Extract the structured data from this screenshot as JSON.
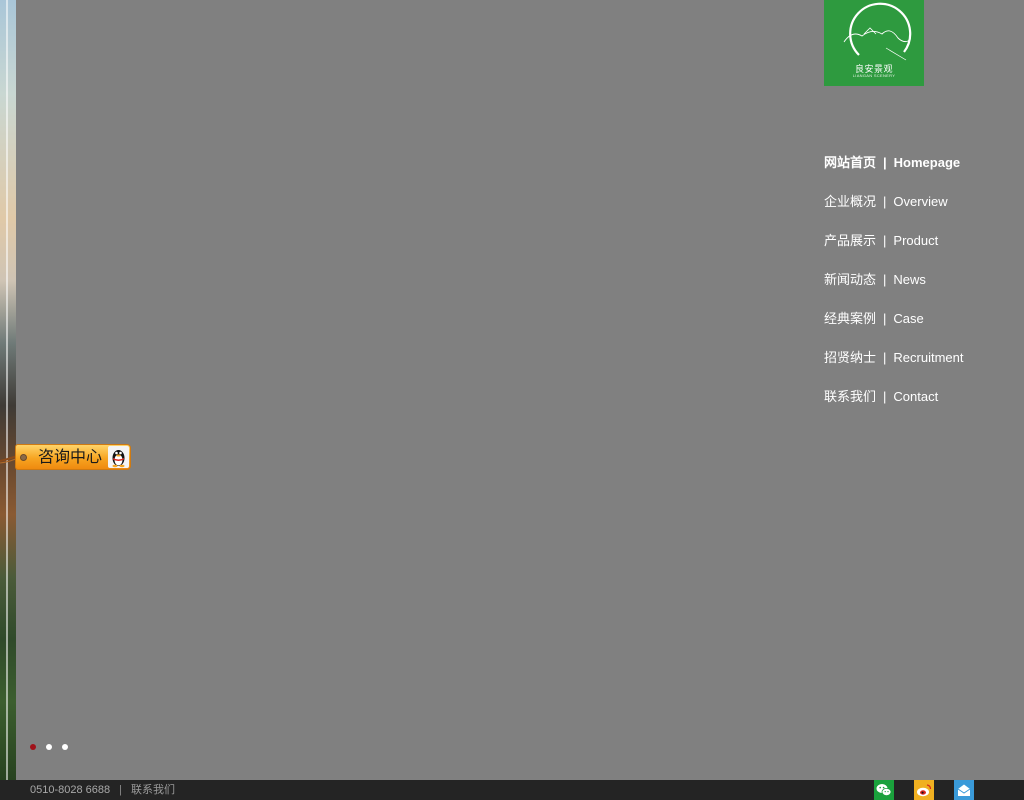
{
  "logo": {
    "name_cn": "良安景观",
    "name_en": "LIANGAN SCENERY",
    "bg_color": "#2e9a3f"
  },
  "nav": {
    "items": [
      {
        "cn": "网站首页",
        "sep": "|",
        "en": "Homepage",
        "active": true
      },
      {
        "cn": "企业概况",
        "sep": "|",
        "en": "Overview"
      },
      {
        "cn": "产品展示",
        "sep": "|",
        "en": "Product"
      },
      {
        "cn": "新闻动态",
        "sep": "|",
        "en": "News"
      },
      {
        "cn": "经典案例",
        "sep": "|",
        "en": "Case"
      },
      {
        "cn": "招贤纳士",
        "sep": "|",
        "en": "Recruitment"
      },
      {
        "cn": "联系我们",
        "sep": "|",
        "en": "Contact"
      }
    ]
  },
  "consult": {
    "label": "咨询中心",
    "icon": "qq-penguin-icon"
  },
  "slider": {
    "dot_count": 3,
    "active_index": 0,
    "active_color": "#a0121a"
  },
  "footer": {
    "phone": "0510-8028 6688",
    "pipe": "|",
    "contact_link": "联系我们",
    "icons": [
      "wechat-icon",
      "weibo-icon",
      "mail-icon"
    ]
  }
}
